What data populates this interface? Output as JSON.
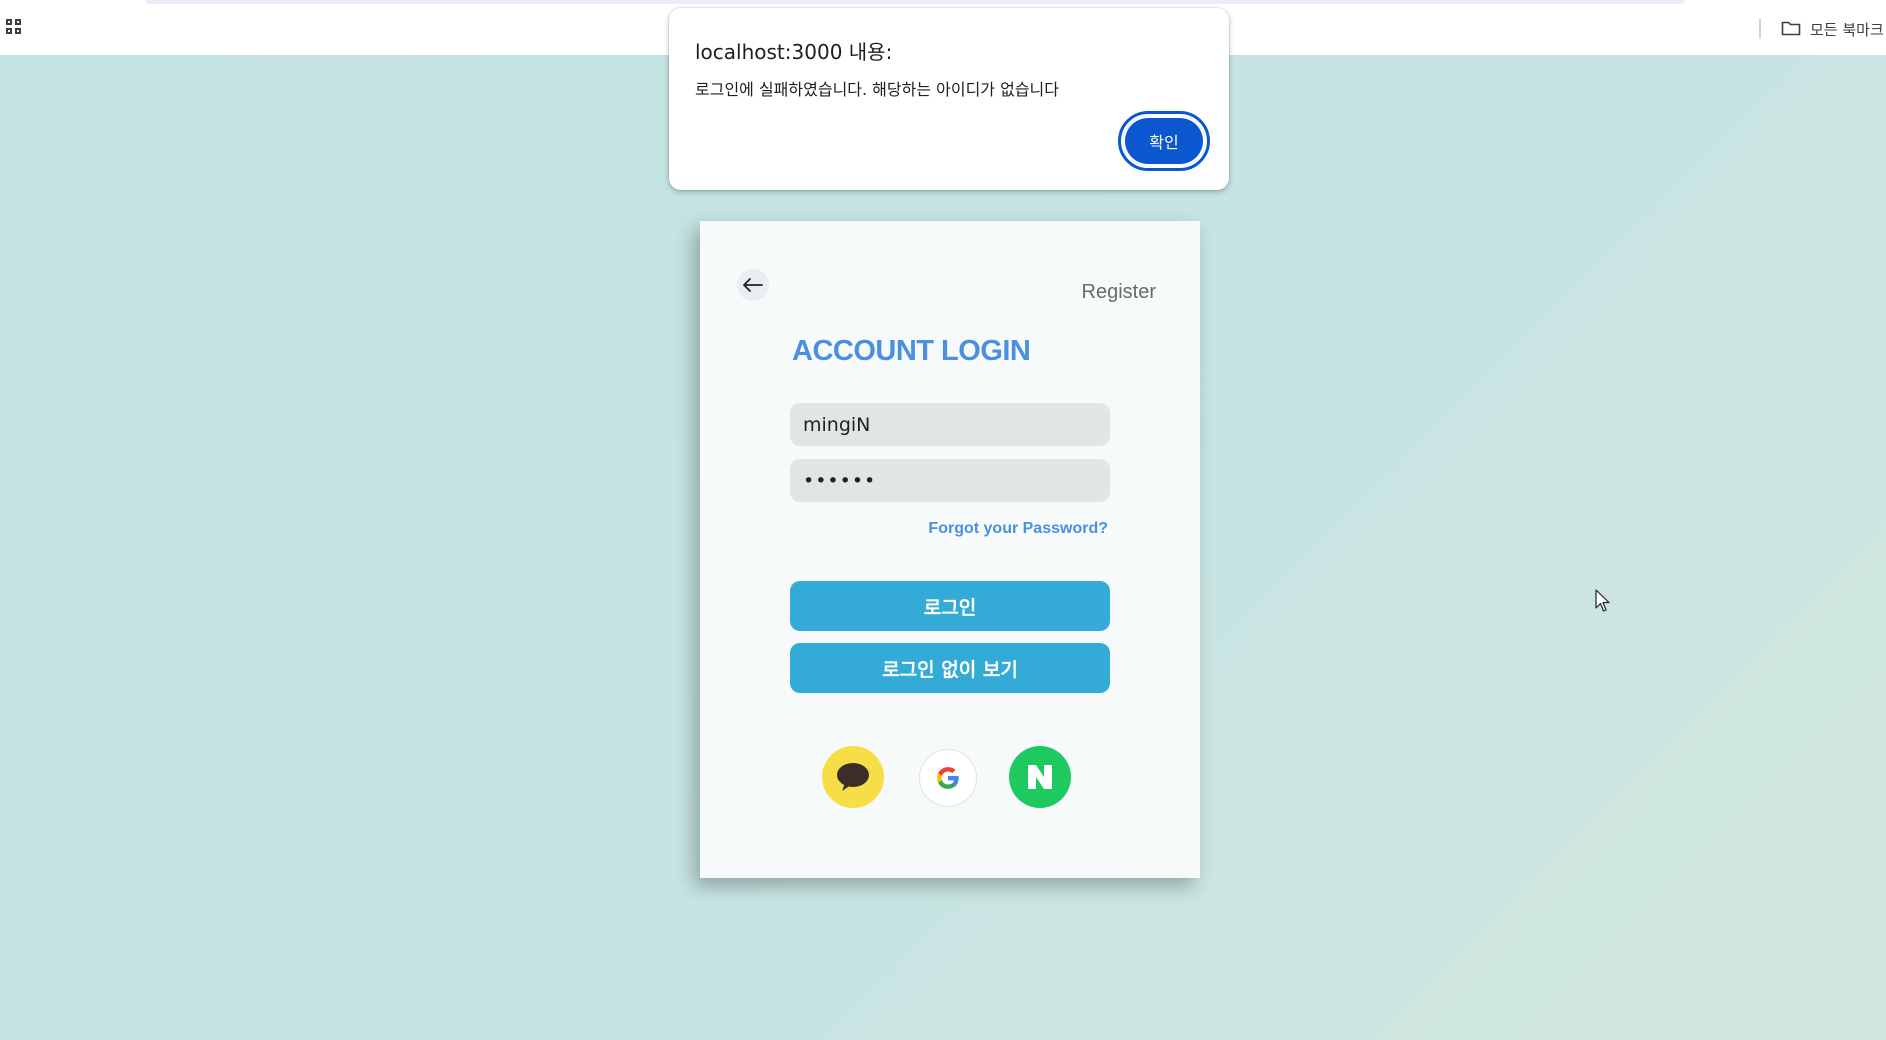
{
  "browser": {
    "bookmarks_label": "모든 북마크"
  },
  "dialog": {
    "title": "localhost:3000 내용:",
    "message": "로그인에 실패하였습니다. 해당하는 아이디가 없습니다",
    "ok_label": "확인",
    "accent_color": "#0b57d0"
  },
  "login_card": {
    "register_label": "Register",
    "title": "ACCOUNT LOGIN",
    "username_value": "mingiN",
    "password_value": "••••••",
    "forgot_label": "Forgot your Password?",
    "login_button": "로그인",
    "guest_button": "로그인 없이 보기",
    "social": [
      {
        "name": "kakao-icon",
        "color": "#f7de47"
      },
      {
        "name": "google-icon",
        "color": "#ffffff"
      },
      {
        "name": "naver-icon",
        "color": "#1ec960"
      }
    ],
    "title_color": "#4a8fe0",
    "button_color": "#33abd6"
  }
}
